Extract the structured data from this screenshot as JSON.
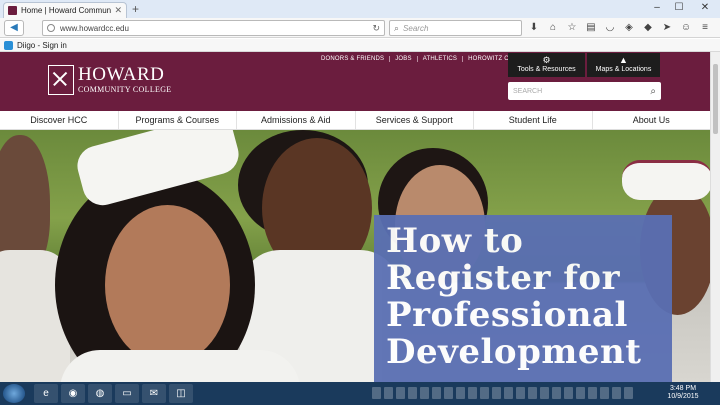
{
  "browser": {
    "tab_title": "Home | Howard Communit...",
    "url": "www.howardcc.edu",
    "search_placeholder": "Search",
    "bookmark": "Diigo - Sign in"
  },
  "site": {
    "logo_main": "HOWARD",
    "logo_sub": "COMMUNITY COLLEGE",
    "utility_links": [
      "DONORS & FRIENDS",
      "JOBS",
      "ATHLETICS",
      "HOROWITZ CENTER"
    ],
    "tools_label": "Tools & Resources",
    "maps_label": "Maps & Locations",
    "search_placeholder": "SEARCH",
    "nav": [
      "Discover HCC",
      "Programs & Courses",
      "Admissions & Aid",
      "Services & Support",
      "Student Life",
      "About Us"
    ],
    "hero_lines": [
      "How to",
      "Register for",
      "Professional",
      "Development"
    ]
  },
  "taskbar": {
    "time": "3:48 PM",
    "date": "10/9/2015"
  },
  "colors": {
    "brand": "#6b1d3e",
    "overlay": "#5a6fb3",
    "taskbar": "#1a3a5c"
  }
}
